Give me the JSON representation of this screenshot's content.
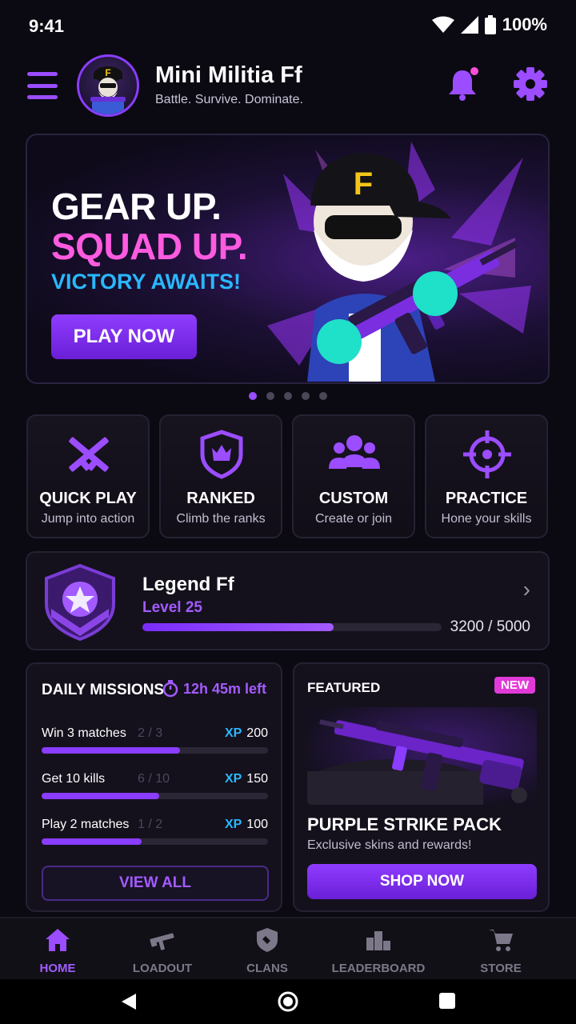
{
  "status_bar": {
    "time": "9:41",
    "battery": "100%"
  },
  "header": {
    "title": "Mini Militia Ff",
    "subtitle": "Battle. Survive. Dominate."
  },
  "hero": {
    "line1": "GEAR UP.",
    "line2": "SQUAD UP.",
    "line3": "VICTORY AWAITS!",
    "cta": "PLAY NOW",
    "slides": 5,
    "active_slide": 1
  },
  "modes": [
    {
      "title": "QUICK PLAY",
      "subtitle": "Jump into action",
      "icon": "crossed-rifles-icon"
    },
    {
      "title": "RANKED",
      "subtitle": "Climb the ranks",
      "icon": "rank-shield-icon"
    },
    {
      "title": "CUSTOM",
      "subtitle": "Create or join",
      "icon": "group-icon"
    },
    {
      "title": "PRACTICE",
      "subtitle": "Hone your skills",
      "icon": "crosshair-icon"
    }
  ],
  "profile": {
    "name": "Legend Ff",
    "level": "Level 25",
    "xp_current": 3200,
    "xp_max": 5000,
    "xp_text": "3200 / 5000"
  },
  "missions": {
    "title": "DAILY MISSIONS",
    "timer": "12h 45m left",
    "items": [
      {
        "label": "Win 3 matches",
        "progress": "2 / 3",
        "xp_tag": "XP",
        "xp": "200",
        "fraction": 0.61
      },
      {
        "label": "Get 10 kills",
        "progress": "6 / 10",
        "xp_tag": "XP",
        "xp": "150",
        "fraction": 0.52
      },
      {
        "label": "Play 2 matches",
        "progress": "1 / 2",
        "xp_tag": "XP",
        "xp": "100",
        "fraction": 0.44
      }
    ],
    "view_all": "VIEW ALL"
  },
  "featured": {
    "label": "FEATURED",
    "badge": "NEW",
    "title": "PURPLE STRIKE PACK",
    "description": "Exclusive skins and rewards!",
    "cta": "SHOP NOW"
  },
  "bottom_nav": [
    {
      "label": "HOME",
      "icon": "home-icon",
      "active": true
    },
    {
      "label": "LOADOUT",
      "icon": "rifle-icon",
      "active": false
    },
    {
      "label": "CLANS",
      "icon": "clan-shield-icon",
      "active": false
    },
    {
      "label": "LEADERBOARD",
      "icon": "podium-icon",
      "active": false
    },
    {
      "label": "STORE",
      "icon": "cart-icon",
      "active": false
    }
  ],
  "colors": {
    "accent": "#9b4dff",
    "pink": "#ff5be0",
    "blue": "#2ab7ff",
    "background": "#0b0a12"
  }
}
